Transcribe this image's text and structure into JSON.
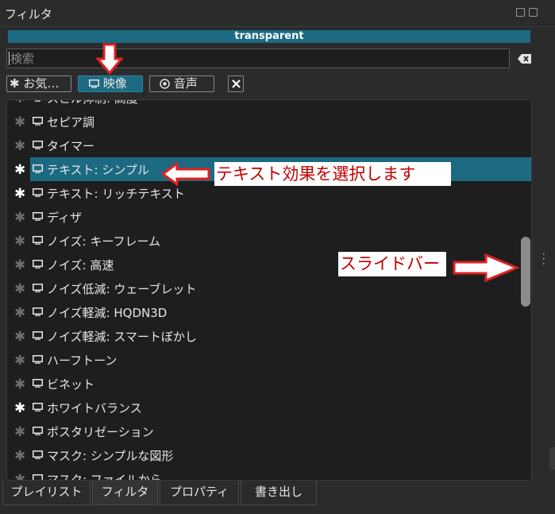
{
  "window": {
    "title": "フィルタ"
  },
  "preset": {
    "label": "transparent"
  },
  "search": {
    "placeholder": "検索",
    "value": ""
  },
  "filter_buttons": {
    "favorite": "お気…",
    "video": "映像",
    "audio": "音声"
  },
  "filters": [
    {
      "label": "スピル抑制: 高度",
      "favorite": false,
      "selected": false
    },
    {
      "label": "セピア調",
      "favorite": false,
      "selected": false
    },
    {
      "label": "タイマー",
      "favorite": false,
      "selected": false
    },
    {
      "label": "テキスト: シンプル",
      "favorite": true,
      "selected": true
    },
    {
      "label": "テキスト: リッチテキスト",
      "favorite": true,
      "selected": false
    },
    {
      "label": "ディザ",
      "favorite": false,
      "selected": false
    },
    {
      "label": "ノイズ: キーフレーム",
      "favorite": false,
      "selected": false
    },
    {
      "label": "ノイズ: 高速",
      "favorite": false,
      "selected": false
    },
    {
      "label": "ノイズ低減: ウェーブレット",
      "favorite": false,
      "selected": false
    },
    {
      "label": "ノイズ軽減: HQDN3D",
      "favorite": false,
      "selected": false
    },
    {
      "label": "ノイズ軽減: スマートぼかし",
      "favorite": false,
      "selected": false
    },
    {
      "label": "ハーフトーン",
      "favorite": false,
      "selected": false
    },
    {
      "label": "ビネット",
      "favorite": false,
      "selected": false
    },
    {
      "label": "ホワイトバランス",
      "favorite": true,
      "selected": false
    },
    {
      "label": "ポスタリゼーション",
      "favorite": false,
      "selected": false
    },
    {
      "label": "マスク: シンプルな図形",
      "favorite": false,
      "selected": false
    },
    {
      "label": "マスク: ファイルから",
      "favorite": false,
      "selected": false
    }
  ],
  "annotations": {
    "select_text": "テキスト効果を選択します",
    "slide_bar": "スライドバー"
  },
  "tabs": {
    "playlist": "プレイリスト",
    "filter": "フィルタ",
    "properties": "プロパティ",
    "export": "書き出し"
  },
  "colors": {
    "accent": "#1c6a82",
    "panel_bg": "#1e1e1e",
    "window_bg": "#2b2b2b",
    "annotation_red": "#e02020"
  }
}
